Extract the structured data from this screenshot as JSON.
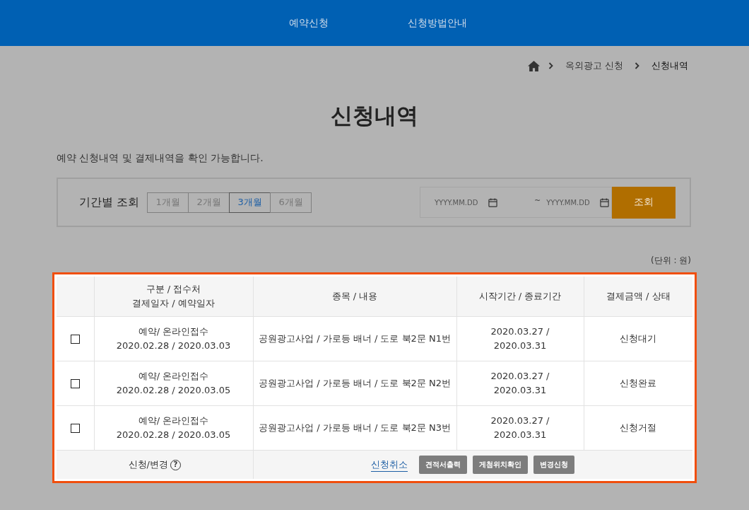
{
  "nav": [
    {
      "label": "예약신청"
    },
    {
      "label": "신청방법안내"
    }
  ],
  "breadcrumb": [
    "옥외광고 신청",
    "신청내역"
  ],
  "title": "신청내역",
  "description": "예약 신청내역 및 결제내역을 확인 가능합니다.",
  "filter": {
    "label": "기간별 조회",
    "periods": [
      {
        "label": "1개월",
        "selected": false
      },
      {
        "label": "2개월",
        "selected": false
      },
      {
        "label": "3개월",
        "selected": true
      },
      {
        "label": "6개월",
        "selected": false
      }
    ],
    "start_date": {
      "placeholder": "YYYY.MM.DD"
    },
    "separator": "~",
    "end_date": {
      "placeholder": "YYYY.MM.DD"
    },
    "search_button": "조회"
  },
  "unit": "(단위 : 원)",
  "table": {
    "columns": [
      [
        "구분 / 접수처",
        "결제일자 / 예약일자"
      ],
      [
        "종목 / 내용"
      ],
      [
        "시작기간 / 종료기간"
      ],
      [
        "결제금액 / 상태"
      ]
    ],
    "rows": [
      {
        "checked": false,
        "type": "예약/ 온라인접수",
        "dates": "2020.02.28 / 2020.03.03",
        "item": "공원광고사업 / 가로등 배너 / 도로 북2문 N1번",
        "start": "2020.03.27 /",
        "end": "2020.03.31",
        "status": "신청대기"
      },
      {
        "checked": false,
        "type": "예약/ 온라인접수",
        "dates": "2020.02.28 / 2020.03.05",
        "item": "공원광고사업 / 가로등 배너 / 도로 북2문 N2번",
        "start": "2020.03.27 /",
        "end": "2020.03.31",
        "status": "신청완료"
      },
      {
        "checked": false,
        "type": "예약/ 온라인접수",
        "dates": "2020.02.28 / 2020.03.05",
        "item": "공원광고사업 / 가로등 배너 / 도로 북2문 N3번",
        "start": "2020.03.27 /",
        "end": "2020.03.31",
        "status": "신청거절"
      }
    ],
    "footer": {
      "label": "신청/변경",
      "help": "?",
      "link": "신청취소",
      "buttons": [
        "견적서출력",
        "게첨위치확인",
        "변경신청"
      ]
    }
  }
}
